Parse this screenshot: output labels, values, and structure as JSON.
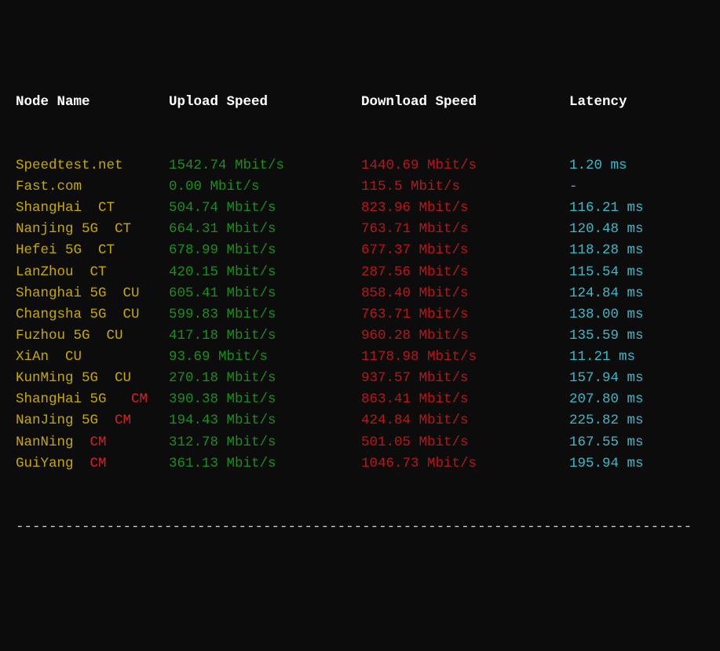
{
  "headers": {
    "node": "Node Name",
    "upload": "Upload Speed",
    "download": "Download Speed",
    "latency": "Latency"
  },
  "rows": [
    {
      "name": "Speedtest.net",
      "carrier": "",
      "upload": "1542.74 Mbit/s",
      "download": "1440.69 Mbit/s",
      "latency": "1.20 ms"
    },
    {
      "name": "Fast.com",
      "carrier": "",
      "upload": "0.00 Mbit/s",
      "download": "115.5 Mbit/s",
      "latency": "-"
    },
    {
      "name": "ShangHai  ",
      "carrier": "CT",
      "upload": "504.74 Mbit/s",
      "download": "823.96 Mbit/s",
      "latency": "116.21 ms"
    },
    {
      "name": "Nanjing 5G  ",
      "carrier": "CT",
      "upload": "664.31 Mbit/s",
      "download": "763.71 Mbit/s",
      "latency": "120.48 ms"
    },
    {
      "name": "Hefei 5G  ",
      "carrier": "CT",
      "upload": "678.99 Mbit/s",
      "download": "677.37 Mbit/s",
      "latency": "118.28 ms"
    },
    {
      "name": "LanZhou  ",
      "carrier": "CT",
      "upload": "420.15 Mbit/s",
      "download": "287.56 Mbit/s",
      "latency": "115.54 ms"
    },
    {
      "name": "Shanghai 5G  ",
      "carrier": "CU",
      "upload": "605.41 Mbit/s",
      "download": "858.40 Mbit/s",
      "latency": "124.84 ms"
    },
    {
      "name": "Changsha 5G  ",
      "carrier": "CU",
      "upload": "599.83 Mbit/s",
      "download": "763.71 Mbit/s",
      "latency": "138.00 ms"
    },
    {
      "name": "Fuzhou 5G  ",
      "carrier": "CU",
      "upload": "417.18 Mbit/s",
      "download": "960.28 Mbit/s",
      "latency": "135.59 ms"
    },
    {
      "name": "XiAn  ",
      "carrier": "CU",
      "upload": "93.69 Mbit/s",
      "download": "1178.98 Mbit/s",
      "latency": "11.21 ms"
    },
    {
      "name": "KunMing 5G  ",
      "carrier": "CU",
      "upload": "270.18 Mbit/s",
      "download": "937.57 Mbit/s",
      "latency": "157.94 ms"
    },
    {
      "name": "ShangHai 5G   ",
      "carrier": "CM",
      "upload": "390.38 Mbit/s",
      "download": "863.41 Mbit/s",
      "latency": "207.80 ms"
    },
    {
      "name": "NanJing 5G  ",
      "carrier": "CM",
      "upload": "194.43 Mbit/s",
      "download": "424.84 Mbit/s",
      "latency": "225.82 ms"
    },
    {
      "name": "NanNing  ",
      "carrier": "CM",
      "upload": "312.78 Mbit/s",
      "download": "501.05 Mbit/s",
      "latency": "167.55 ms"
    },
    {
      "name": "GuiYang  ",
      "carrier": "CM",
      "upload": "361.13 Mbit/s",
      "download": "1046.73 Mbit/s",
      "latency": "195.94 ms"
    }
  ],
  "divider": "----------------------------------------------------------------------------------"
}
